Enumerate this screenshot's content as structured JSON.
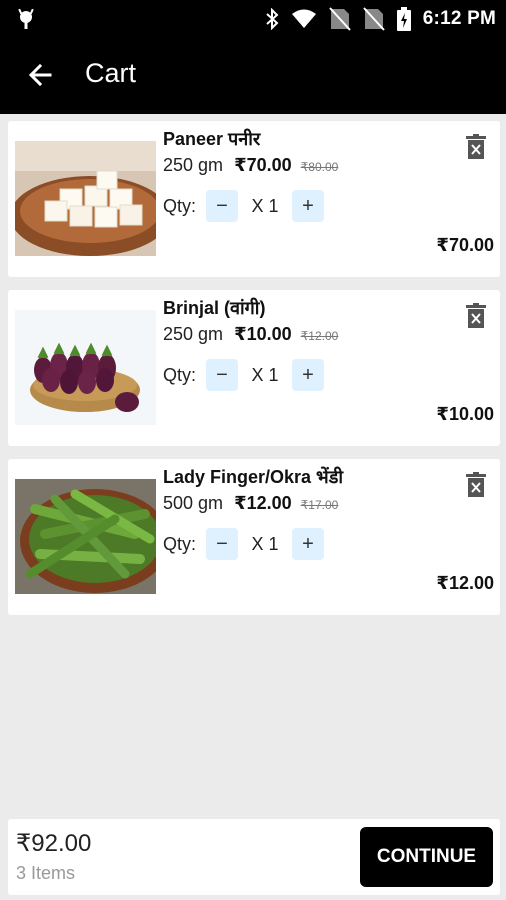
{
  "status_bar": {
    "time": "6:12 PM",
    "icons": [
      "android-icon",
      "bluetooth-icon",
      "wifi-icon",
      "no-sim-icon",
      "no-sim-icon",
      "battery-charging-icon"
    ]
  },
  "app_bar": {
    "title": "Cart",
    "back_icon": "arrow-left-icon"
  },
  "cart": {
    "items": [
      {
        "name": "Paneer पनीर",
        "weight": "250 gm",
        "price": "₹70.00",
        "mrp": "₹80.00",
        "qty_label": "Qty:",
        "qty": "X 1",
        "total": "₹70.00"
      },
      {
        "name": "Brinjal (वांगी)",
        "weight": "250 gm",
        "price": "₹10.00",
        "mrp": "₹12.00",
        "qty_label": "Qty:",
        "qty": "X 1",
        "total": "₹10.00"
      },
      {
        "name": "Lady Finger/Okra  भेंडी",
        "weight": "500 gm",
        "price": "₹12.00",
        "mrp": "₹17.00",
        "qty_label": "Qty:",
        "qty": "X 1",
        "total": "₹12.00"
      }
    ],
    "minus_symbol": "−",
    "plus_symbol": "+"
  },
  "footer": {
    "total": "₹92.00",
    "items_count": "3 Items",
    "continue_label": "CONTINUE"
  }
}
